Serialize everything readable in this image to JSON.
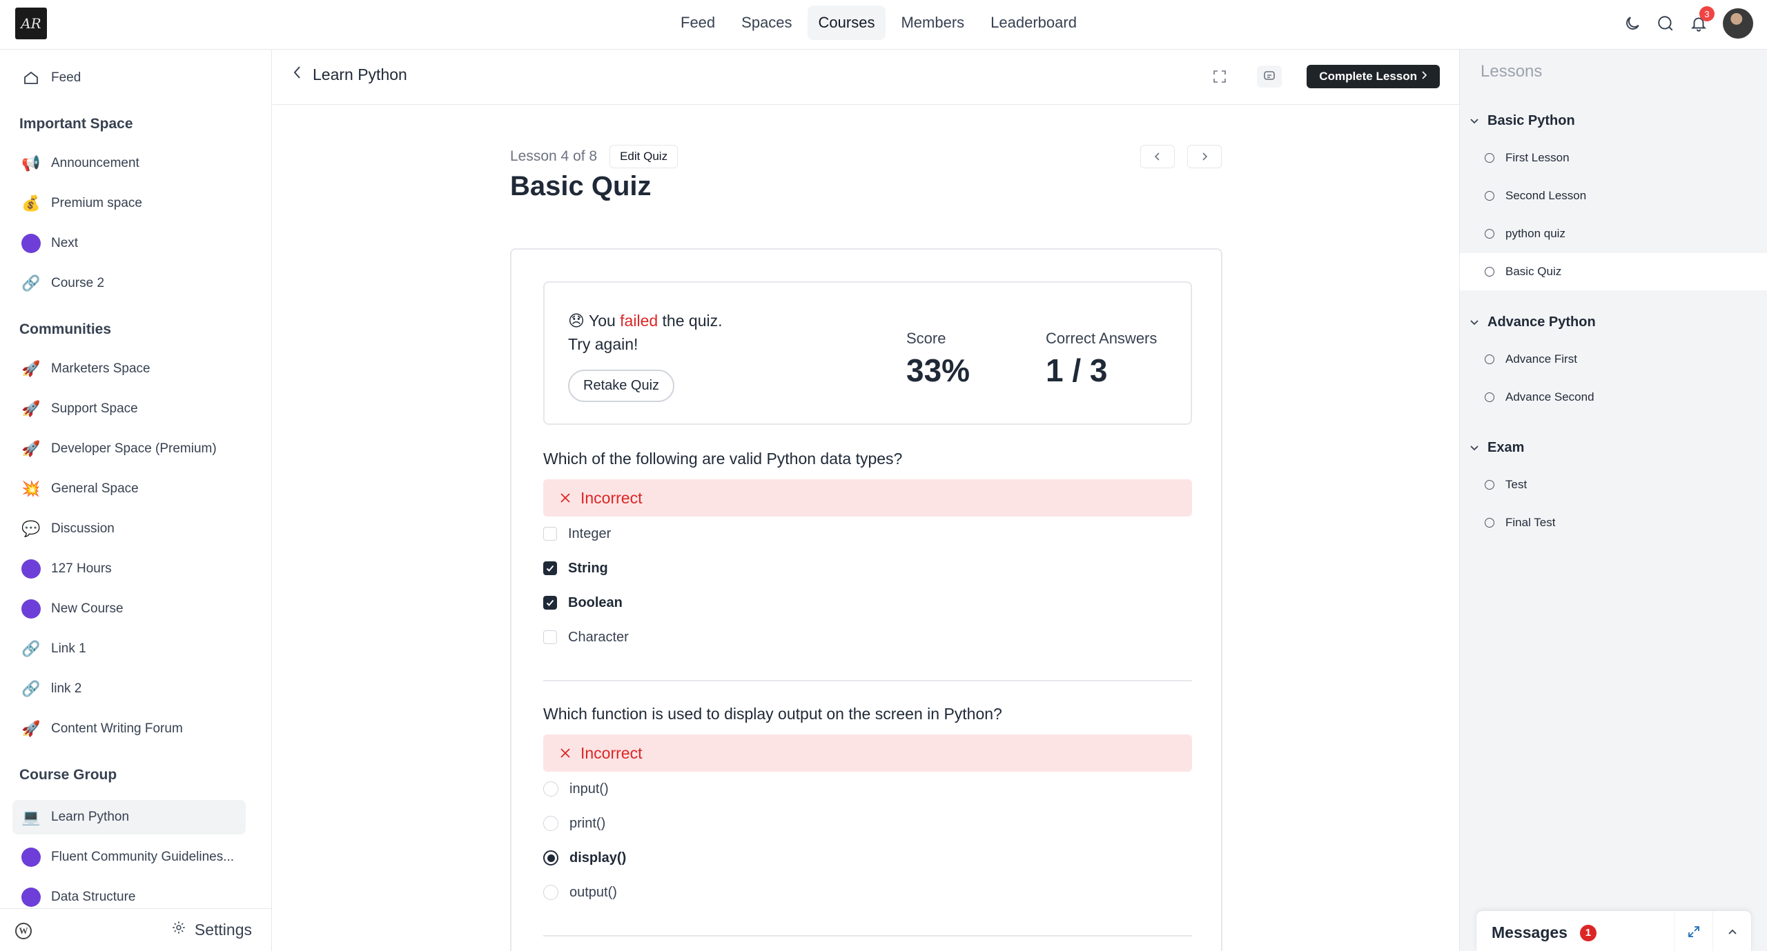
{
  "app": {
    "logo_text": "AR"
  },
  "topnav": {
    "items": [
      "Feed",
      "Spaces",
      "Courses",
      "Members",
      "Leaderboard"
    ],
    "active": "Courses",
    "notification_count": "3"
  },
  "sidebar": {
    "feed_label": "Feed",
    "sections": [
      {
        "title": "Important Space",
        "items": [
          {
            "label": "Announcement",
            "icon": "megaphone-icon"
          },
          {
            "label": "Premium space",
            "icon": "money-bag-icon"
          },
          {
            "label": "Next",
            "icon": "purple-dot-icon"
          },
          {
            "label": "Course 2",
            "icon": "link-icon"
          }
        ]
      },
      {
        "title": "Communities",
        "items": [
          {
            "label": "Marketers Space",
            "icon": "rocket-icon"
          },
          {
            "label": "Support Space",
            "icon": "rocket-icon"
          },
          {
            "label": "Developer Space (Premium)",
            "icon": "rocket-icon"
          },
          {
            "label": "General Space",
            "icon": "collision-icon"
          },
          {
            "label": "Discussion",
            "icon": "speech-bubble-icon"
          },
          {
            "label": "127 Hours",
            "icon": "purple-dot-icon"
          },
          {
            "label": "New Course",
            "icon": "purple-dot-icon"
          },
          {
            "label": "Link 1",
            "icon": "link-icon"
          },
          {
            "label": "link 2",
            "icon": "link-icon"
          },
          {
            "label": "Content Writing Forum",
            "icon": "rocket-icon"
          }
        ]
      },
      {
        "title": "Course Group",
        "items": [
          {
            "label": "Learn Python",
            "icon": "laptop-icon"
          },
          {
            "label": "Fluent Community Guidelines...",
            "icon": "purple-dot-icon"
          },
          {
            "label": "Data Structure",
            "icon": "purple-dot-icon"
          }
        ]
      }
    ],
    "settings_label": "Settings"
  },
  "content_header": {
    "back_label": "Learn Python",
    "complete_label": "Complete Lesson"
  },
  "lesson": {
    "count_label": "Lesson 4 of 8",
    "edit_label": "Edit Quiz",
    "title": "Basic Quiz"
  },
  "result": {
    "emoji": "😞",
    "msg_you": "You",
    "msg_failed": "failed",
    "msg_rest": "the quiz.",
    "msg_try": "Try again!",
    "retake_label": "Retake Quiz",
    "score_label": "Score",
    "score_value": "33%",
    "correct_label": "Correct Answers",
    "correct_value": "1 / 3"
  },
  "questions": [
    {
      "text": "Which of the following are valid Python data types?",
      "status": "Incorrect",
      "type": "checkbox",
      "options": [
        {
          "label": "Integer",
          "selected": false
        },
        {
          "label": "String",
          "selected": true
        },
        {
          "label": "Boolean",
          "selected": true
        },
        {
          "label": "Character",
          "selected": false
        }
      ]
    },
    {
      "text": "Which function is used to display output on the screen in Python?",
      "status": "Incorrect",
      "type": "radio",
      "options": [
        {
          "label": "input()",
          "selected": false
        },
        {
          "label": "print()",
          "selected": false
        },
        {
          "label": "display()",
          "selected": true
        },
        {
          "label": "output()",
          "selected": false
        }
      ]
    }
  ],
  "lessons_panel": {
    "title": "Lessons",
    "groups": [
      {
        "title": "Basic Python",
        "items": [
          "First Lesson",
          "Second Lesson",
          "python quiz",
          "Basic Quiz"
        ]
      },
      {
        "title": "Advance Python",
        "items": [
          "Advance First",
          "Advance Second"
        ]
      },
      {
        "title": "Exam",
        "items": [
          "Test",
          "Final Test"
        ]
      }
    ],
    "active_item": "Basic Quiz"
  },
  "messages": {
    "label": "Messages",
    "count": "1"
  },
  "colors": {
    "accent_dark": "#1f2428",
    "error": "#dc2626",
    "error_bg": "#fde4e4",
    "space_dot": "#6d3fd8"
  }
}
